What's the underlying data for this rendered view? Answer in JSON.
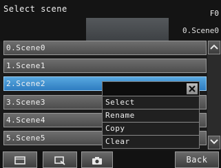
{
  "header": {
    "title": "Select scene",
    "corner_code": "F0",
    "current_scene": "0.Scene0"
  },
  "scene_list": [
    {
      "label": "0.Scene0",
      "selected": false
    },
    {
      "label": "1.Scene1",
      "selected": false
    },
    {
      "label": "2.Scene2",
      "selected": true
    },
    {
      "label": "3.Scene3",
      "selected": false
    },
    {
      "label": "4.Scene4",
      "selected": false
    },
    {
      "label": "5.Scene5",
      "selected": false
    }
  ],
  "context_menu": {
    "close_icon": "close-icon",
    "items": [
      "Select",
      "Rename",
      "Copy",
      "Clear"
    ]
  },
  "scrollbar": {
    "up_icon": "chevron-up-icon",
    "down_icon": "chevron-down-icon"
  },
  "footer": {
    "buttons": [
      {
        "icon": "layout-icon"
      },
      {
        "icon": "zoom-icon"
      },
      {
        "icon": "camera-icon"
      }
    ],
    "back_label": "Back"
  },
  "colors": {
    "selected_row": "#3a8fd0",
    "row": "#5a5a5a",
    "background": "#1a1a1a"
  }
}
